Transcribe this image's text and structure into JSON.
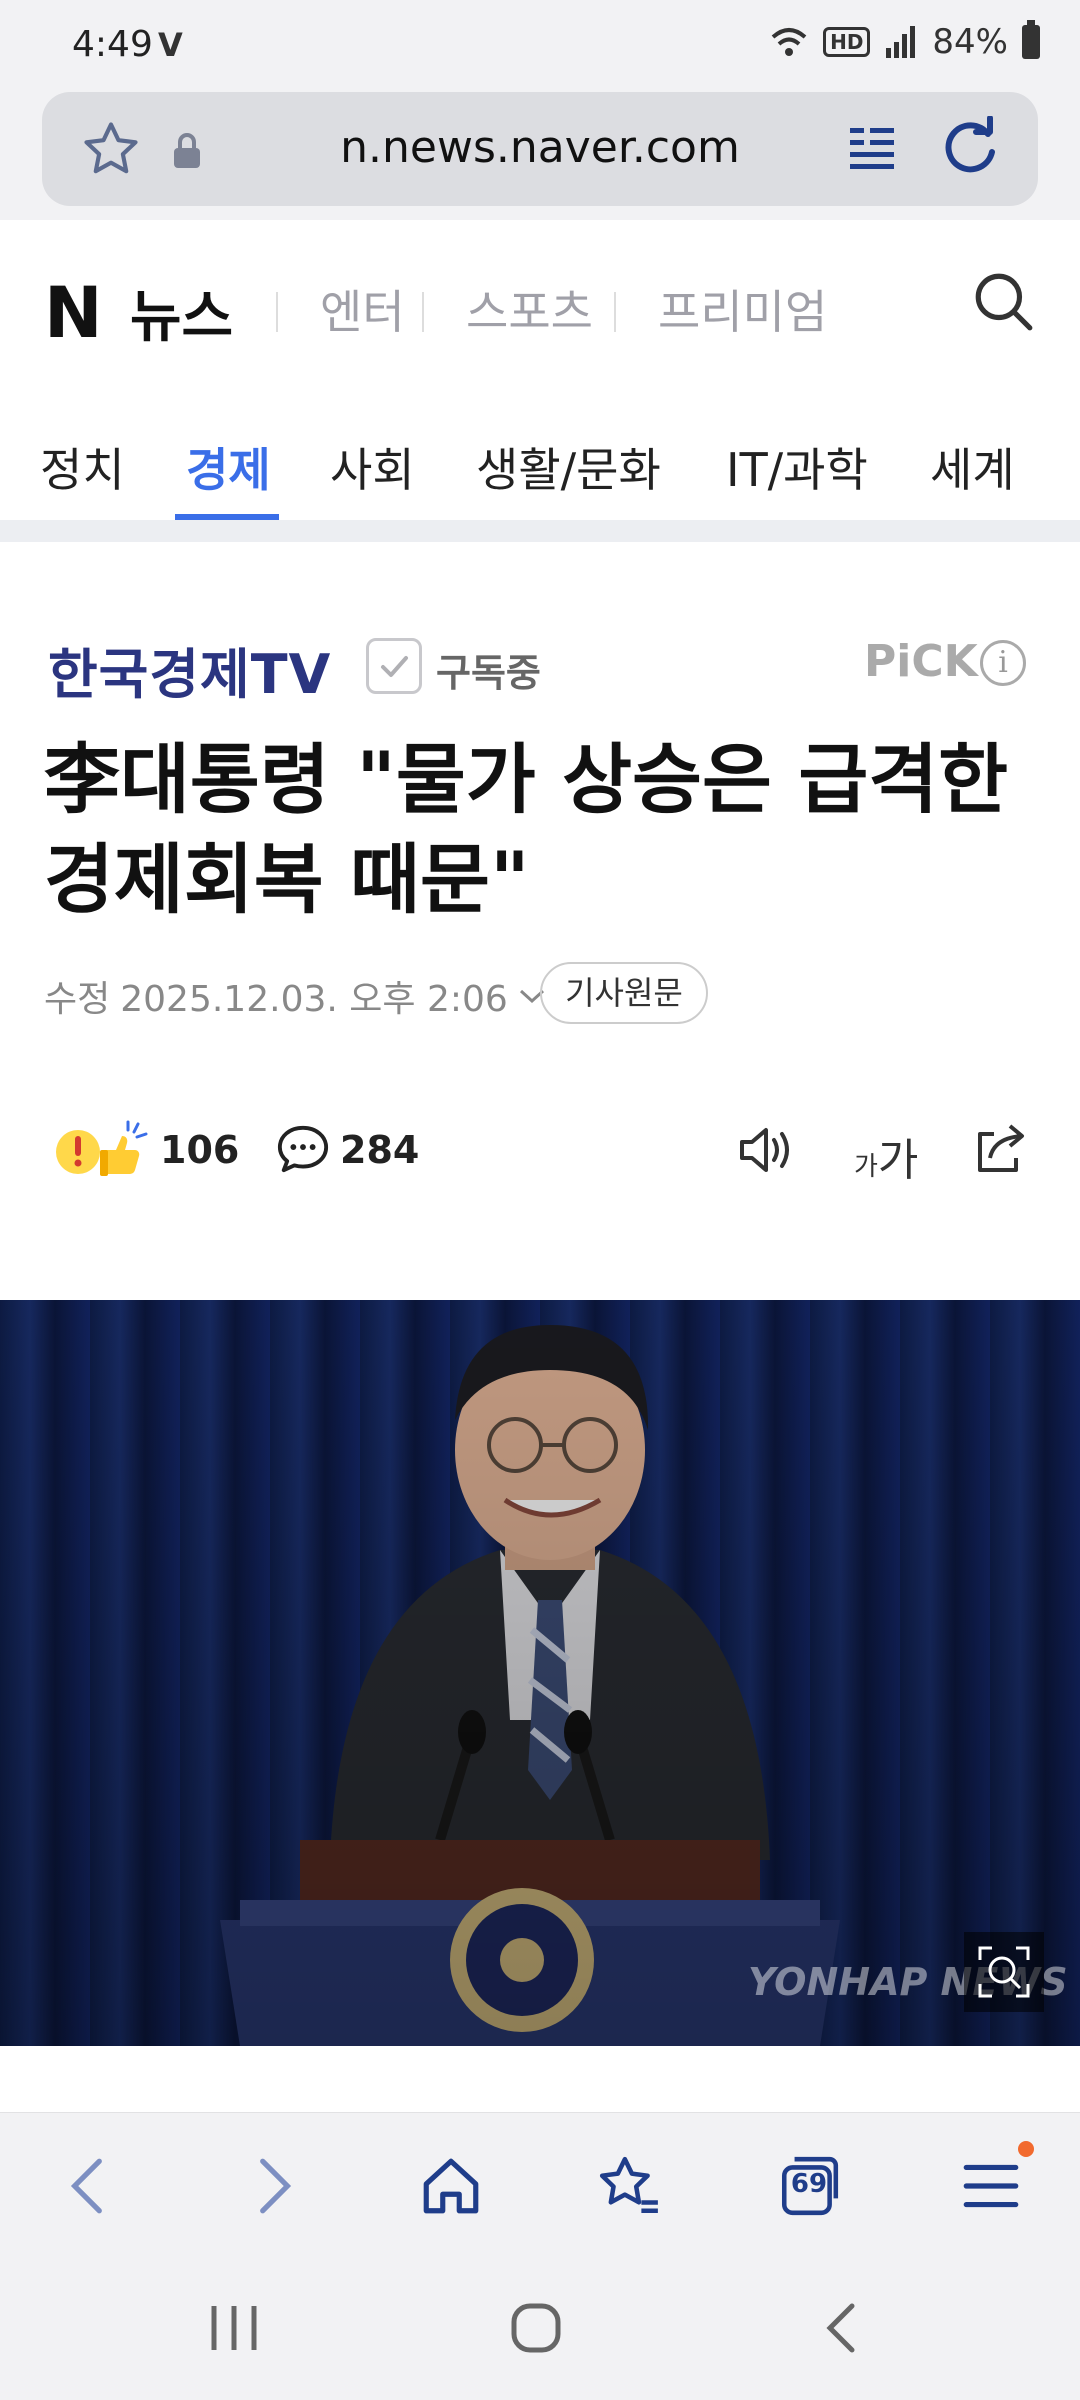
{
  "status_bar": {
    "time": "4:49",
    "carrier_icon": "volte-icon",
    "battery_percent": "84%"
  },
  "browser": {
    "url": "n.news.naver.com",
    "tabs_count": "69"
  },
  "naver": {
    "logo_n": "N",
    "logo_news": "뉴스",
    "header_links": [
      "엔터",
      "스포츠",
      "프리미엄"
    ],
    "categories": [
      "정치",
      "경제",
      "사회",
      "생활/문화",
      "IT/과학",
      "세계"
    ],
    "active_category": "경제",
    "accent_color": "#3a6ee8"
  },
  "article": {
    "press": "한국경제TV",
    "subscribe_label": "구독중",
    "pick_label": "PiCK",
    "headline": "李대통령 \"물가 상승은 급격한 경제회복 때문\"",
    "date_label": "수정",
    "date_value": "2025.12.03. 오후 2:06",
    "original_button": "기사원문",
    "reaction_count": "106",
    "comment_count": "284",
    "font_size_small": "가",
    "font_size_large": "가",
    "photo_watermark": "YONHAP NEWS"
  }
}
